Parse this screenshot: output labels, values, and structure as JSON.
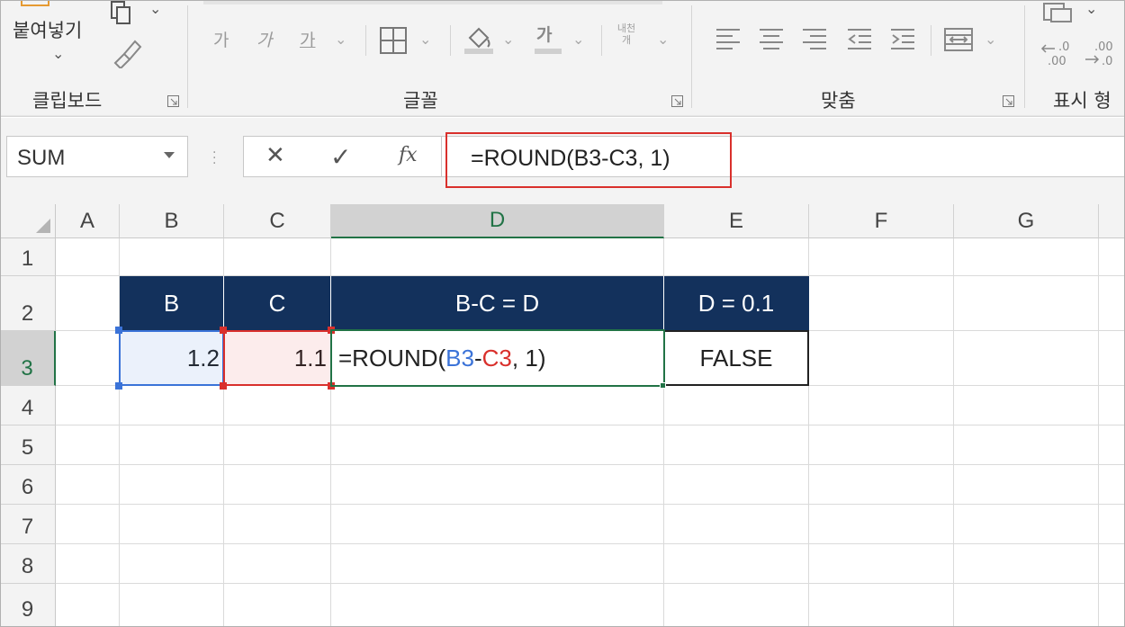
{
  "ribbon": {
    "paste_label": "붙여넣기",
    "groups": {
      "clipboard": "클립보드",
      "font": "글꼴",
      "alignment": "맞춤",
      "number": "표시 형"
    },
    "font_buttons": [
      "가",
      "가",
      "가"
    ],
    "font_color_glyph": "가",
    "wrap_text": "내천\n개"
  },
  "formula_bar": {
    "name_box": "SUM",
    "cancel_icon": "✕",
    "enter_icon": "✓",
    "fx_label": "fx",
    "formula": "=ROUND(B3-C3, 1)"
  },
  "grid": {
    "columns": [
      "A",
      "B",
      "C",
      "D",
      "E",
      "F",
      "G"
    ],
    "selected_column": "D",
    "rows": [
      "1",
      "2",
      "3",
      "4",
      "5",
      "6",
      "7",
      "8",
      "9"
    ],
    "selected_row": "3",
    "table": {
      "headers": [
        "B",
        "C",
        "B-C = D",
        "D = 0.1"
      ],
      "row3": {
        "b": "1.2",
        "c": "1.1",
        "d_parts": [
          "=ROUND(",
          "B3",
          "-",
          "C3",
          ", 1)"
        ],
        "e": "FALSE"
      }
    }
  },
  "colors": {
    "header_fill": "#13315c",
    "accent_green": "#217346",
    "ref_blue": "#3b73d8",
    "ref_red": "#d9302c"
  }
}
